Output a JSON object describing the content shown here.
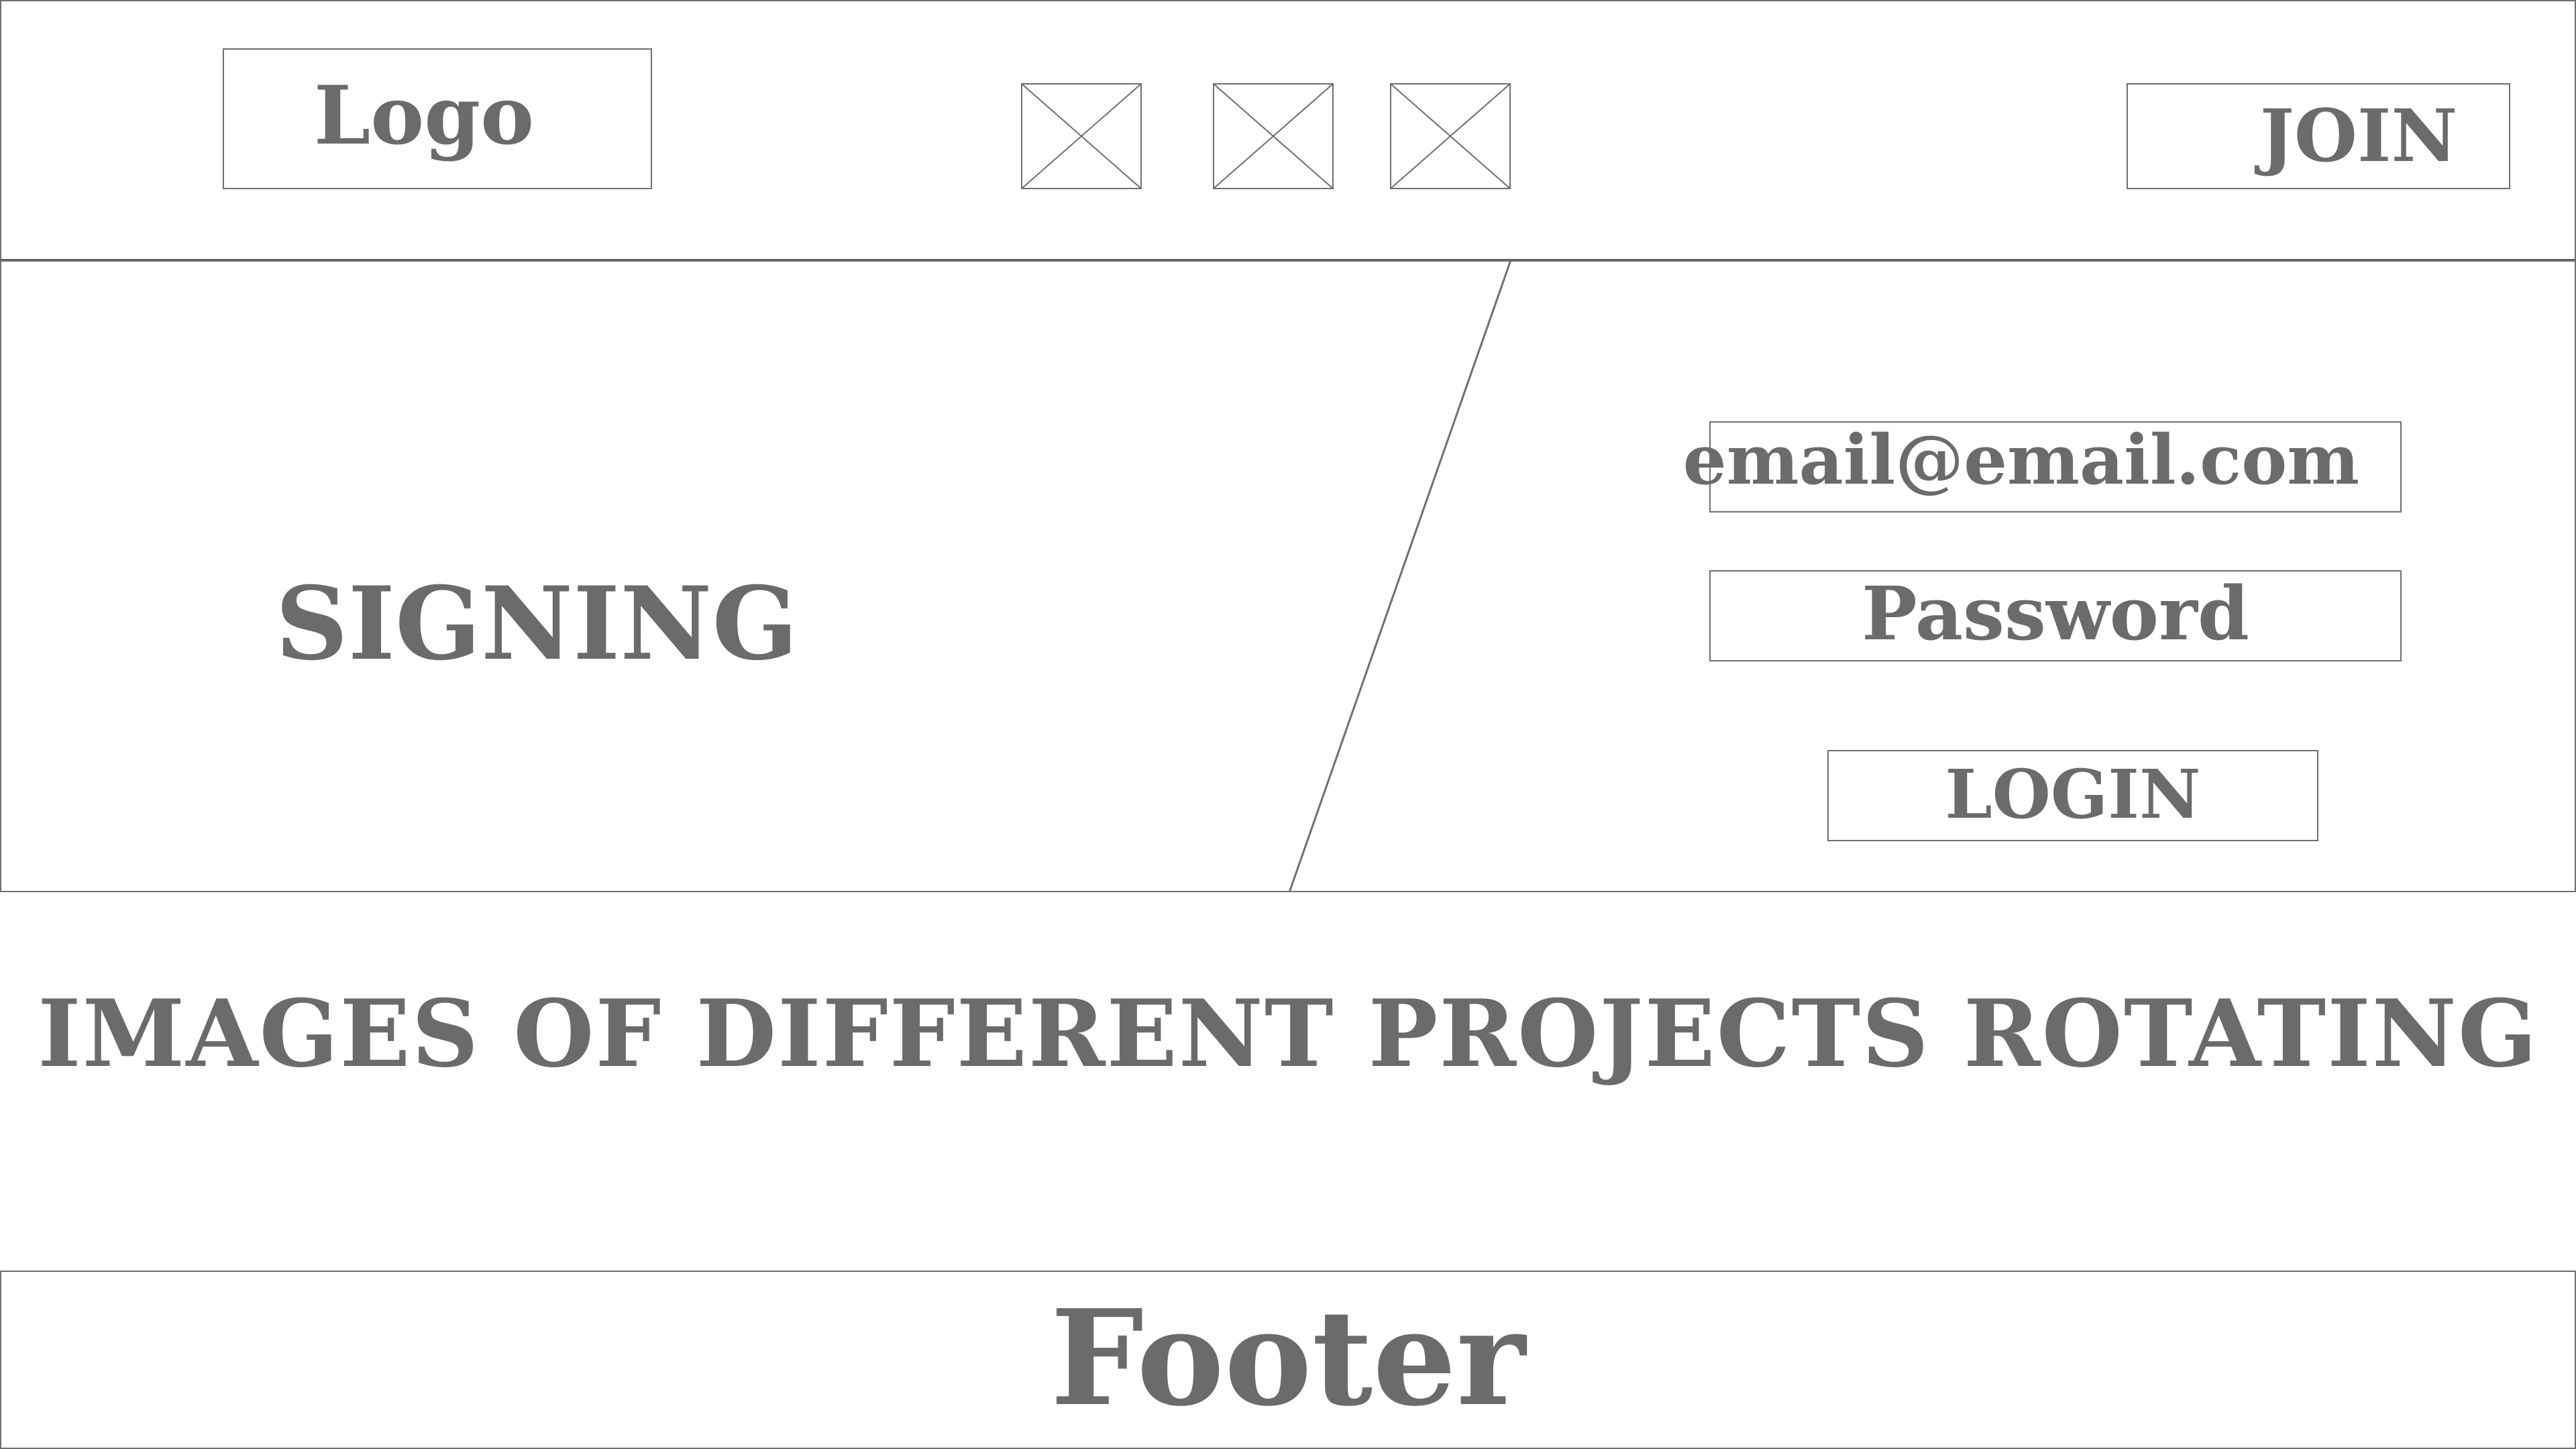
{
  "header": {
    "logo_label": "Logo",
    "nav_items": [
      {
        "icon": "image-placeholder-icon"
      },
      {
        "icon": "image-placeholder-icon"
      },
      {
        "icon": "image-placeholder-icon"
      }
    ],
    "join_label": "JOIN"
  },
  "hero": {
    "title": "SIGNING",
    "email_value": "email@email.com",
    "password_value": "Password",
    "login_label": "LOGIN"
  },
  "carousel": {
    "caption": "IMAGES OF DIFFERENT PROJECTS ROTATING"
  },
  "footer": {
    "label": "Footer"
  },
  "colors": {
    "stroke": "#6f6f6f",
    "text": "#6b6b6b",
    "background": "#ffffff"
  }
}
